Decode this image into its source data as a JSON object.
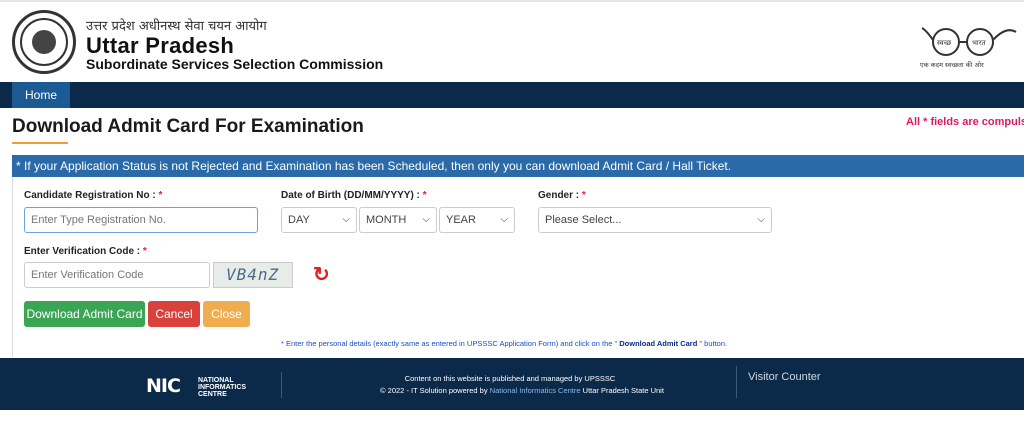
{
  "header": {
    "hindi_title": "उत्तर प्रदेश अधीनस्थ सेवा चयन आयोग",
    "title": "Uttar Pradesh",
    "subtitle": "Subordinate Services Selection Commission",
    "swachh_label_left": "स्वच्छ",
    "swachh_label_right": "भारत",
    "swachh_tagline": "एक कदम स्वच्छता की ओर"
  },
  "nav": {
    "home_label": "Home"
  },
  "page": {
    "title": "Download Admit Card For Examination",
    "required_note": "All * fields are compulsory",
    "info_bar": "* If your Application Status is not Rejected and Examination has been Scheduled, then only you can download Admit Card / Hall Ticket."
  },
  "form": {
    "registration_label": "Candidate Registration No : ",
    "registration_placeholder": "Enter Type Registration No.",
    "dob_label": "Date of Birth (DD/MM/YYYY) : ",
    "dob_day": "DAY",
    "dob_month": "MONTH",
    "dob_year": "YEAR",
    "gender_label": "Gender : ",
    "gender_value": "Please Select...",
    "verification_label": "Enter Verification Code : ",
    "verification_placeholder": "Enter Verification Code",
    "captcha_text": "VB4nZ",
    "required_star": "*"
  },
  "buttons": {
    "download": "Download Admit Card",
    "cancel": "Cancel",
    "close": "Close"
  },
  "note": {
    "prefix": "* Enter the personal details (exactly same as entered in UPSSSC Application Form) and click on the \" ",
    "highlight": "Download Admit Card",
    "suffix": " \" button."
  },
  "footer": {
    "nic_mark": "NIC",
    "nic_line1": "NATIONAL",
    "nic_line2": "INFORMATICS",
    "nic_line3": "CENTRE",
    "line1": "Content on this website is published and managed by UPSSSC",
    "line2_prefix": "© 2022 - IT Solution powered by ",
    "line2_link": "National Informatics Centre",
    "line2_suffix": " Uttar Pradesh State Unit",
    "visitor_counter": "Visitor Counter"
  },
  "colors": {
    "nav_bg": "#0b2a4a",
    "info_bar_bg": "#2a6aa8",
    "accent_red": "#e0195a",
    "btn_green": "#3aa655",
    "btn_red": "#d8413c",
    "btn_orange": "#f0ad4e"
  }
}
